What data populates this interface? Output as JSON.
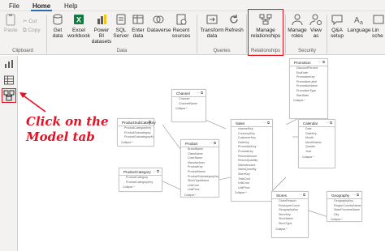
{
  "menu": {
    "file": "File",
    "home": "Home",
    "help": "Help"
  },
  "ribbon": {
    "clipboard": {
      "paste": "Paste",
      "cut": "Cut",
      "copy": "Copy",
      "label": "Clipboard"
    },
    "data": {
      "get_data": [
        "Get",
        "data"
      ],
      "excel": [
        "Excel",
        "workbook"
      ],
      "powerbi": [
        "Power BI",
        "datasets"
      ],
      "sql": [
        "SQL",
        "Server"
      ],
      "enter": [
        "Enter",
        "data"
      ],
      "dataverse": [
        "Dataverse"
      ],
      "recent": [
        "Recent",
        "sources"
      ],
      "label": "Data"
    },
    "queries": {
      "transform": [
        "Transform",
        "data"
      ],
      "refresh": [
        "Refresh"
      ],
      "label": "Queries"
    },
    "relationships": {
      "manage": [
        "Manage",
        "relationships"
      ],
      "label": "Relationships"
    },
    "security": {
      "manage_roles": [
        "Manage",
        "roles"
      ],
      "view_as": [
        "View",
        "as"
      ],
      "label": "Security"
    },
    "qa": {
      "qa_setup": [
        "Q&A",
        "setup"
      ],
      "language": [
        "Language"
      ],
      "linguistic": [
        "Lin",
        "sche"
      ]
    }
  },
  "annotation": {
    "line1": "Click on the",
    "line2": "Model tab"
  },
  "colors": {
    "accent": "#e81123",
    "tab_underline": "#2b6cb0"
  },
  "tables": [
    {
      "id": "channel",
      "title": "Channel",
      "fields": [
        "Channel",
        "ChannelName"
      ]
    },
    {
      "id": "promotion",
      "title": "Promotion",
      "fields": [
        "DiscountPercent",
        "EndDate",
        "PromotionKey",
        "PromotionLabel",
        "PromotionName",
        "PromotionType",
        "StartDate"
      ]
    },
    {
      "id": "productsubcategory",
      "title": "ProductSubCategory",
      "fields": [
        "ProductCategoryKey",
        "ProductSubcategory",
        "ProductSubcategoryKey"
      ]
    },
    {
      "id": "sales",
      "title": "Sales",
      "fields": [
        "channelKey",
        "CurrencyKey",
        "CustomerKey",
        "DateKey",
        "PromotionKey",
        "ProductKey",
        "ReturnAmount",
        "ReturnQuantity",
        "SalesAmount",
        "SalesQuantity",
        "StoreKey",
        "TotalCost",
        "UnitCost",
        "UnitPrice"
      ]
    },
    {
      "id": "calendar",
      "title": "Calendar",
      "fields": [
        "Date",
        "DateKey",
        "Month",
        "MonthName",
        "Quarter",
        "Year"
      ]
    },
    {
      "id": "product",
      "title": "Product",
      "fields": [
        "BrandName",
        "ClassName",
        "ColorName",
        "Manufacturer",
        "ProductKey",
        "ProductName",
        "ProductSubcategoryKey",
        "StockTypeName",
        "UnitCost",
        "UnitPrice"
      ]
    },
    {
      "id": "productcategory",
      "title": "ProductCategory",
      "fields": [
        "ProductCategory",
        "ProductCategoryKey"
      ]
    },
    {
      "id": "stores",
      "title": "Stores",
      "fields": [
        "CloseReason",
        "EmployeeCount",
        "GeographyKey",
        "StoreKey",
        "StoreName",
        "StoreType"
      ]
    },
    {
      "id": "geography",
      "title": "Geography",
      "fields": [
        "GeographyKey",
        "RegionCountryName",
        "StateProvinceName",
        "City"
      ]
    }
  ],
  "collapse_label": "Collapse ^"
}
